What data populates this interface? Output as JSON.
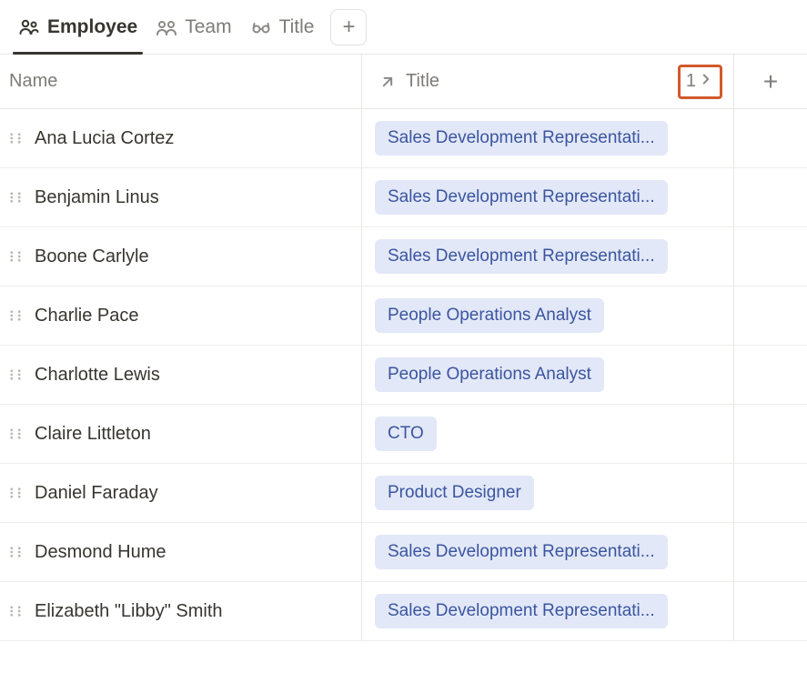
{
  "tabs": [
    {
      "label": "Employee",
      "icon": "people-icon",
      "active": true
    },
    {
      "label": "Team",
      "icon": "team-icon",
      "active": false
    },
    {
      "label": "Title",
      "icon": "glasses-icon",
      "active": false
    }
  ],
  "columns": {
    "name": {
      "label": "Name"
    },
    "title": {
      "label": "Title",
      "relation_count": "1"
    }
  },
  "rows": [
    {
      "name": "Ana Lucia Cortez",
      "title": "Sales Development Representati..."
    },
    {
      "name": "Benjamin Linus",
      "title": "Sales Development Representati..."
    },
    {
      "name": "Boone Carlyle",
      "title": "Sales Development Representati..."
    },
    {
      "name": "Charlie Pace",
      "title": "People Operations Analyst"
    },
    {
      "name": "Charlotte Lewis",
      "title": "People Operations Analyst"
    },
    {
      "name": "Claire Littleton",
      "title": "CTO"
    },
    {
      "name": "Daniel Faraday",
      "title": "Product Designer"
    },
    {
      "name": "Desmond Hume",
      "title": "Sales Development Representati..."
    },
    {
      "name": "Elizabeth \"Libby\" Smith",
      "title": "Sales Development Representati..."
    }
  ]
}
